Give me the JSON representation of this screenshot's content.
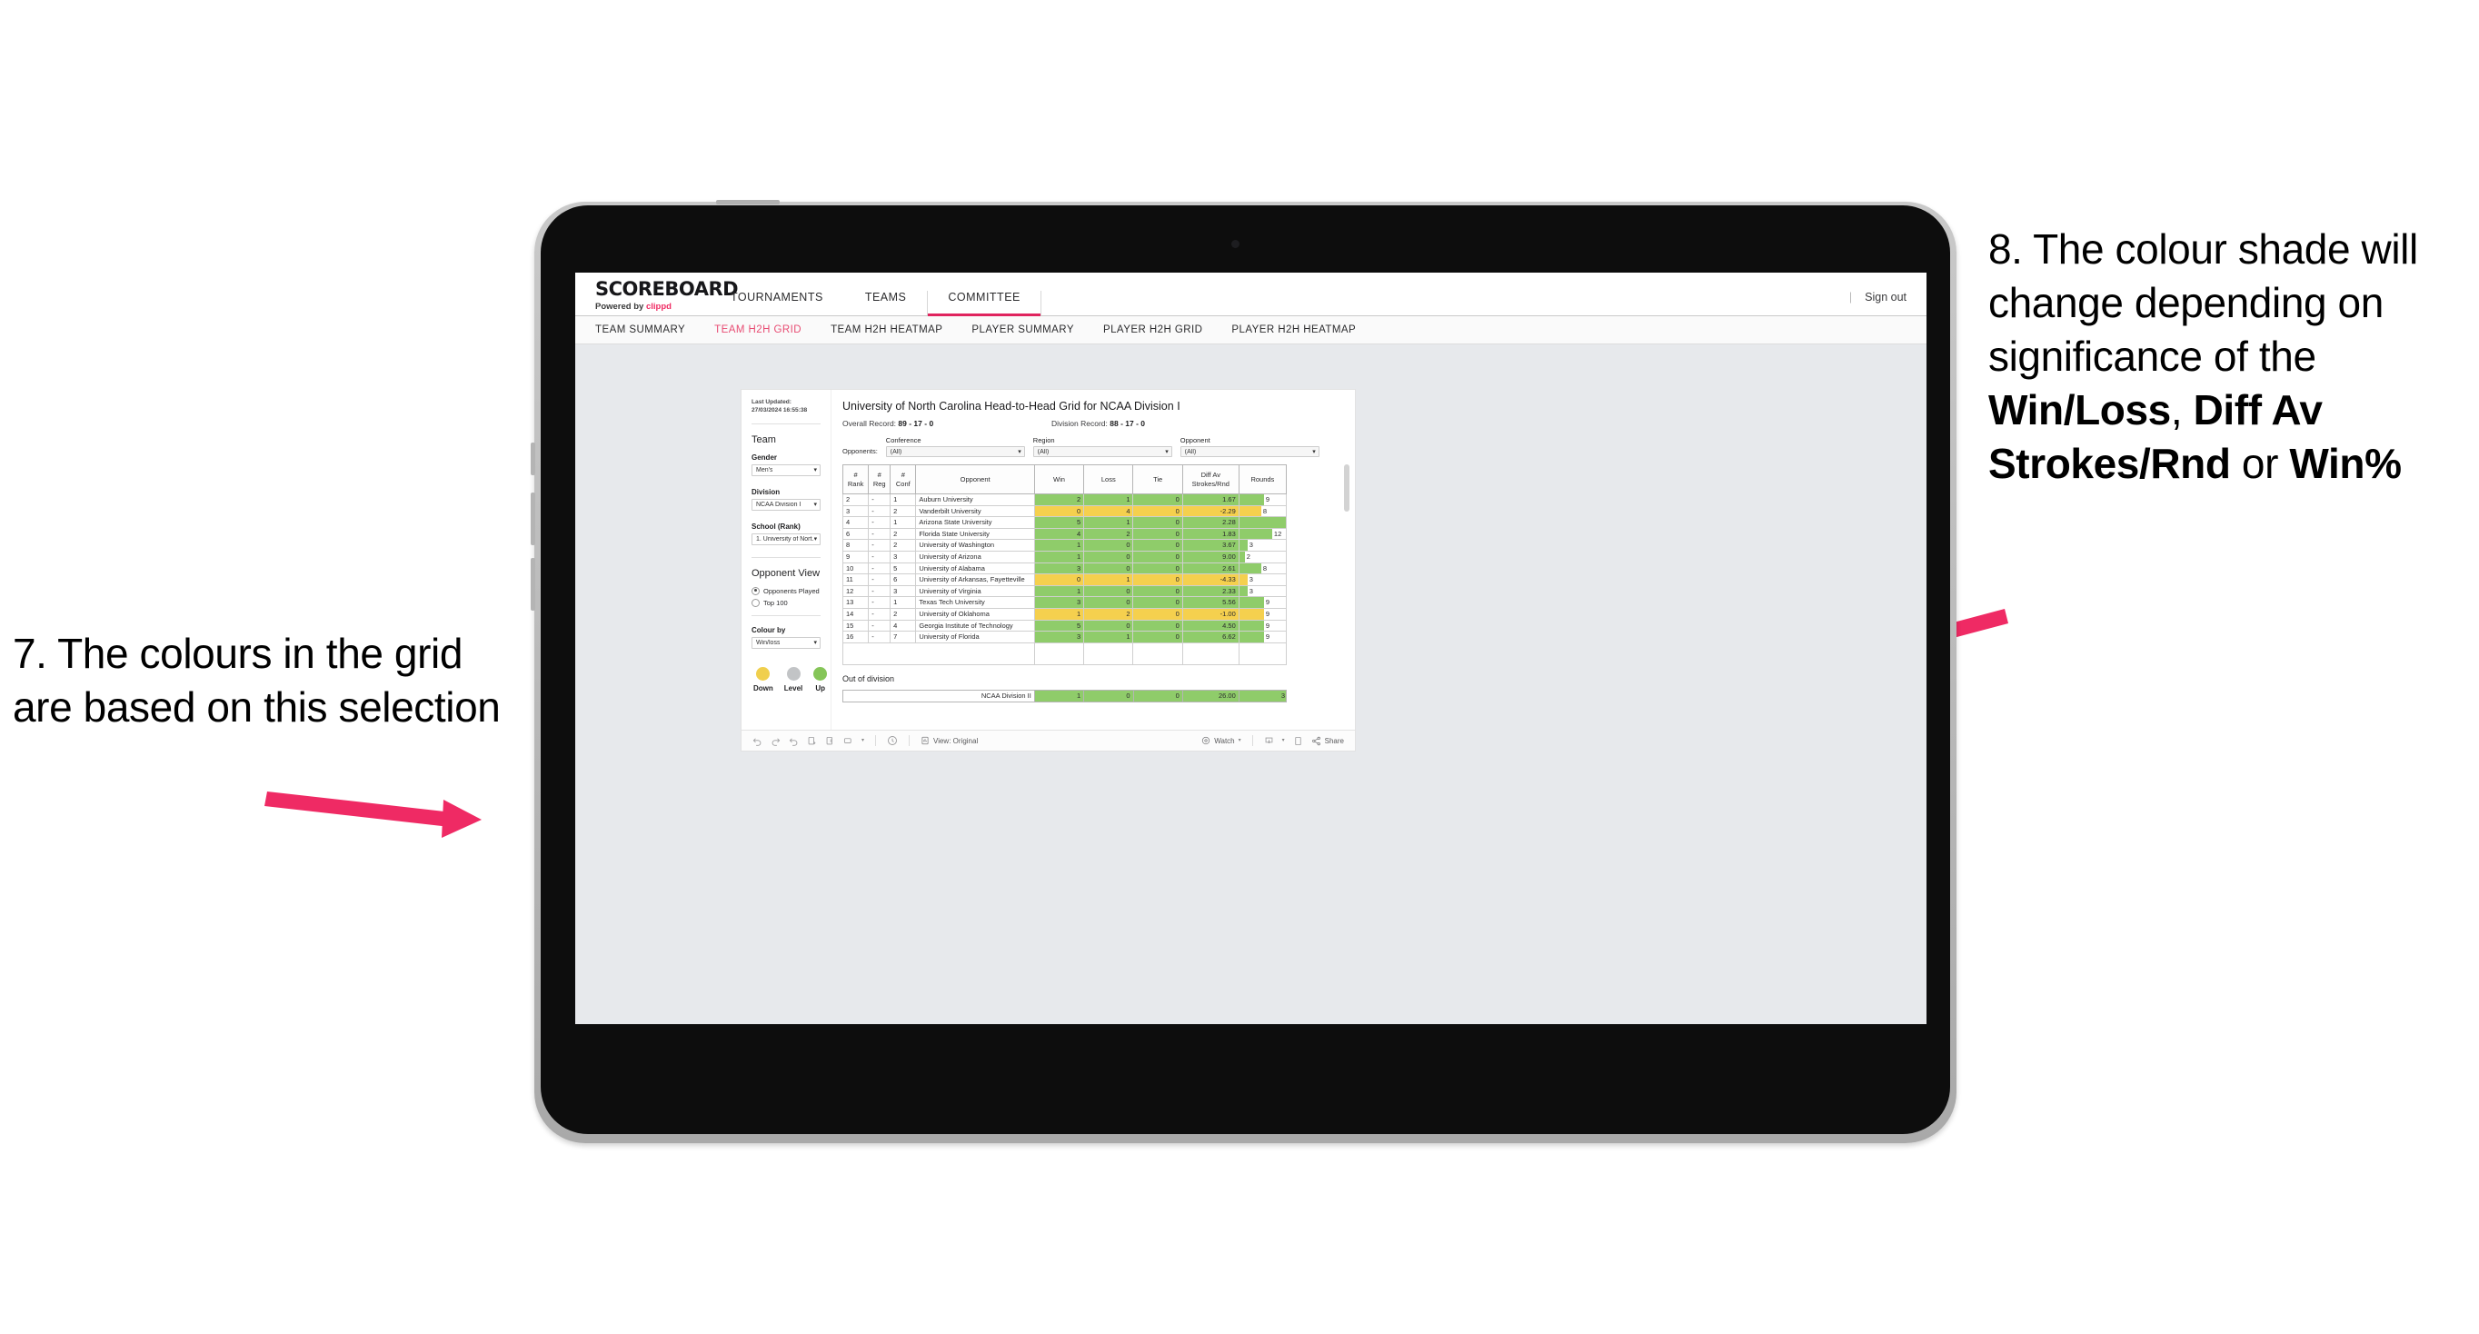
{
  "annotations": {
    "left": {
      "number": "7.",
      "text": "7. The colours in the grid are based on this selection"
    },
    "right": {
      "pre": "8. The colour shade will change depending on significance of the ",
      "b1": "Win/Loss",
      "mid1": ", ",
      "b2": "Diff Av Strokes/Rnd",
      "mid2": " or ",
      "b3": "Win%"
    },
    "arrow_color": "#ef2a64"
  },
  "app": {
    "brand": {
      "title": "SCOREBOARD",
      "powered_prefix": "Powered by ",
      "powered_brand": "clippd"
    },
    "topnav": [
      {
        "label": "TOURNAMENTS",
        "active": false
      },
      {
        "label": "TEAMS",
        "active": false
      },
      {
        "label": "COMMITTEE",
        "active": true
      }
    ],
    "signout": {
      "divider": "|",
      "label": "Sign out"
    },
    "subnav": [
      {
        "label": "TEAM SUMMARY",
        "active": false
      },
      {
        "label": "TEAM H2H GRID",
        "active": true
      },
      {
        "label": "TEAM H2H HEATMAP",
        "active": false
      },
      {
        "label": "PLAYER SUMMARY",
        "active": false
      },
      {
        "label": "PLAYER H2H GRID",
        "active": false
      },
      {
        "label": "PLAYER H2H HEATMAP",
        "active": false
      }
    ]
  },
  "panel": {
    "last_updated_label": "Last Updated:",
    "last_updated_value": "27/03/2024 16:55:38",
    "team_heading": "Team",
    "gender": {
      "label": "Gender",
      "value": "Men's"
    },
    "division": {
      "label": "Division",
      "value": "NCAA Division I"
    },
    "school": {
      "label": "School (Rank)",
      "value": "1. University of Nort..."
    },
    "opponent_view": {
      "heading": "Opponent View",
      "options": [
        {
          "label": "Opponents Played",
          "selected": true
        },
        {
          "label": "Top 100",
          "selected": false
        }
      ]
    },
    "colour_by": {
      "label": "Colour by",
      "value": "Win/loss"
    },
    "legend": [
      {
        "label": "Down",
        "color": "#f0cf4d"
      },
      {
        "label": "Level",
        "color": "#c2c4c6"
      },
      {
        "label": "Up",
        "color": "#85c558"
      }
    ]
  },
  "report": {
    "title": "University of North Carolina Head-to-Head Grid for NCAA Division I",
    "overall_record_label": "Overall Record: ",
    "overall_record_value": "89 - 17 - 0",
    "division_record_label": "Division Record: ",
    "division_record_value": "88 - 17 - 0",
    "opponents_label": "Opponents:",
    "filters": [
      {
        "label": "Conference",
        "value": "(All)"
      },
      {
        "label": "Region",
        "value": "(All)"
      },
      {
        "label": "Opponent",
        "value": "(All)"
      }
    ],
    "columns": [
      "# Rank",
      "# Reg",
      "# Conf",
      "Opponent",
      "Win",
      "Loss",
      "Tie",
      "Diff Av Strokes/Rnd",
      "Rounds"
    ],
    "columns_split": [
      {
        "l1": "#",
        "l2": "Rank"
      },
      {
        "l1": "#",
        "l2": "Reg"
      },
      {
        "l1": "#",
        "l2": "Conf"
      },
      {
        "l1": "",
        "l2": "Opponent"
      },
      {
        "l1": "",
        "l2": "Win"
      },
      {
        "l1": "",
        "l2": "Loss"
      },
      {
        "l1": "",
        "l2": "Tie"
      },
      {
        "l1": "Diff Av",
        "l2": "Strokes/Rnd"
      },
      {
        "l1": "",
        "l2": "Rounds"
      }
    ],
    "rows": [
      {
        "rank": "2",
        "reg": "-",
        "conf": "1",
        "opponent": "Auburn University",
        "win": "2",
        "loss": "1",
        "tie": "0",
        "diff": "1.67",
        "rounds": "9",
        "state": "up"
      },
      {
        "rank": "3",
        "reg": "-",
        "conf": "2",
        "opponent": "Vanderbilt University",
        "win": "0",
        "loss": "4",
        "tie": "0",
        "diff": "-2.29",
        "rounds": "8",
        "state": "down"
      },
      {
        "rank": "4",
        "reg": "-",
        "conf": "1",
        "opponent": "Arizona State University",
        "win": "5",
        "loss": "1",
        "tie": "0",
        "diff": "2.28",
        "rounds": "17",
        "state": "up"
      },
      {
        "rank": "6",
        "reg": "-",
        "conf": "2",
        "opponent": "Florida State University",
        "win": "4",
        "loss": "2",
        "tie": "0",
        "diff": "1.83",
        "rounds": "12",
        "state": "up"
      },
      {
        "rank": "8",
        "reg": "-",
        "conf": "2",
        "opponent": "University of Washington",
        "win": "1",
        "loss": "0",
        "tie": "0",
        "diff": "3.67",
        "rounds": "3",
        "state": "up"
      },
      {
        "rank": "9",
        "reg": "-",
        "conf": "3",
        "opponent": "University of Arizona",
        "win": "1",
        "loss": "0",
        "tie": "0",
        "diff": "9.00",
        "rounds": "2",
        "state": "up"
      },
      {
        "rank": "10",
        "reg": "-",
        "conf": "5",
        "opponent": "University of Alabama",
        "win": "3",
        "loss": "0",
        "tie": "0",
        "diff": "2.61",
        "rounds": "8",
        "state": "up"
      },
      {
        "rank": "11",
        "reg": "-",
        "conf": "6",
        "opponent": "University of Arkansas, Fayetteville",
        "win": "0",
        "loss": "1",
        "tie": "0",
        "diff": "-4.33",
        "rounds": "3",
        "state": "down"
      },
      {
        "rank": "12",
        "reg": "-",
        "conf": "3",
        "opponent": "University of Virginia",
        "win": "1",
        "loss": "0",
        "tie": "0",
        "diff": "2.33",
        "rounds": "3",
        "state": "up"
      },
      {
        "rank": "13",
        "reg": "-",
        "conf": "1",
        "opponent": "Texas Tech University",
        "win": "3",
        "loss": "0",
        "tie": "0",
        "diff": "5.56",
        "rounds": "9",
        "state": "up"
      },
      {
        "rank": "14",
        "reg": "-",
        "conf": "2",
        "opponent": "University of Oklahoma",
        "win": "1",
        "loss": "2",
        "tie": "0",
        "diff": "-1.00",
        "rounds": "9",
        "state": "down"
      },
      {
        "rank": "15",
        "reg": "-",
        "conf": "4",
        "opponent": "Georgia Institute of Technology",
        "win": "5",
        "loss": "0",
        "tie": "0",
        "diff": "4.50",
        "rounds": "9",
        "state": "up"
      },
      {
        "rank": "16",
        "reg": "-",
        "conf": "7",
        "opponent": "University of Florida",
        "win": "3",
        "loss": "1",
        "tie": "0",
        "diff": "6.62",
        "rounds": "9",
        "state": "up"
      }
    ],
    "out_of_division": {
      "heading": "Out of division",
      "row": {
        "label": "NCAA Division II",
        "win": "1",
        "loss": "0",
        "tie": "0",
        "diff": "26.00",
        "rounds": "3",
        "state": "up"
      }
    }
  },
  "toolbar": {
    "view_label": "View: Original",
    "watch_label": "Watch",
    "share_label": "Share"
  },
  "chart_data": {
    "type": "table",
    "title": "University of North Carolina Head-to-Head Grid for NCAA Division I",
    "colour_by": "Win/loss",
    "legend": {
      "Down": "#f0cf4d",
      "Level": "#c2c4c6",
      "Up": "#85c558"
    },
    "columns": [
      "# Rank",
      "# Reg",
      "# Conf",
      "Opponent",
      "Win",
      "Loss",
      "Tie",
      "Diff Av Strokes/Rnd",
      "Rounds"
    ],
    "rounds_max": 17,
    "rows": [
      [
        "2",
        "-",
        "1",
        "Auburn University",
        2,
        1,
        0,
        1.67,
        9
      ],
      [
        "3",
        "-",
        "2",
        "Vanderbilt University",
        0,
        4,
        0,
        -2.29,
        8
      ],
      [
        "4",
        "-",
        "1",
        "Arizona State University",
        5,
        1,
        0,
        2.28,
        17
      ],
      [
        "6",
        "-",
        "2",
        "Florida State University",
        4,
        2,
        0,
        1.83,
        12
      ],
      [
        "8",
        "-",
        "2",
        "University of Washington",
        1,
        0,
        0,
        3.67,
        3
      ],
      [
        "9",
        "-",
        "3",
        "University of Arizona",
        1,
        0,
        0,
        9.0,
        2
      ],
      [
        "10",
        "-",
        "5",
        "University of Alabama",
        3,
        0,
        0,
        2.61,
        8
      ],
      [
        "11",
        "-",
        "6",
        "University of Arkansas, Fayetteville",
        0,
        1,
        0,
        -4.33,
        3
      ],
      [
        "12",
        "-",
        "3",
        "University of Virginia",
        1,
        0,
        0,
        2.33,
        3
      ],
      [
        "13",
        "-",
        "1",
        "Texas Tech University",
        3,
        0,
        0,
        5.56,
        9
      ],
      [
        "14",
        "-",
        "2",
        "University of Oklahoma",
        1,
        2,
        0,
        -1.0,
        9
      ],
      [
        "15",
        "-",
        "4",
        "Georgia Institute of Technology",
        5,
        0,
        0,
        4.5,
        9
      ],
      [
        "16",
        "-",
        "7",
        "University of Florida",
        3,
        1,
        0,
        6.62,
        9
      ]
    ],
    "out_of_division": [
      [
        "NCAA Division II",
        1,
        0,
        0,
        26.0,
        3
      ]
    ],
    "overall_record": "89 - 17 - 0",
    "division_record": "88 - 17 - 0"
  }
}
